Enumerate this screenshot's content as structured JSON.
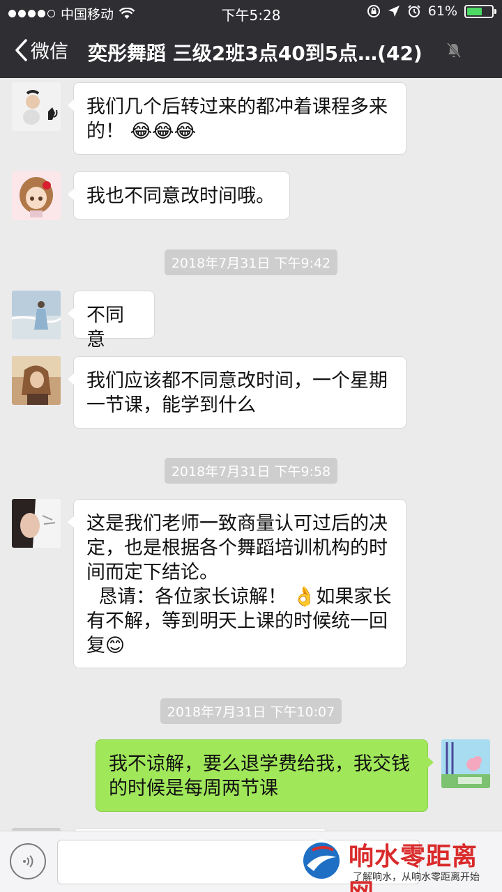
{
  "status_bar": {
    "carrier": "中国移动",
    "time": "下午5:28",
    "battery": "61%",
    "battery_level": 0.61
  },
  "nav": {
    "back_label": "微信",
    "title": "奕彤舞蹈 三级2班3点40到5点…(42)"
  },
  "messages": [
    {
      "type": "in",
      "text": "我们几个后转过来的都冲着课程多来\n的！ 😂😂😂"
    },
    {
      "type": "in",
      "text": "我也不同意改时间哦。"
    },
    {
      "type": "time",
      "text": "2018年7月31日 下午9:42"
    },
    {
      "type": "in",
      "text": "不同意"
    },
    {
      "type": "in",
      "text": "我们应该都不同意改时间，一个星期\n一节课，能学到什么"
    },
    {
      "type": "time",
      "text": "2018年7月31日 下午9:58"
    },
    {
      "type": "in",
      "text": "这是我们老师一致商量认可过后的决\n定，也是根据各个舞蹈培训机构的时\n间而定下结论。\n  恳请：各位家长谅解！ 👌如果家长\n有不解，等到明天上课的时候统一回\n复😊"
    },
    {
      "type": "time",
      "text": "2018年7月31日 下午10:07"
    },
    {
      "type": "out",
      "text": "我不谅解，要么退学费给我，我交钱\n的时候是每周两节课"
    }
  ],
  "watermark": {
    "title": "响水零距离网",
    "subtitle": "了解响水，从响水零距离开始"
  },
  "colors": {
    "nav_bg": "#2e2e33",
    "chat_bg": "#ebebeb",
    "out_bubble": "#a0e75a",
    "in_bubble": "#ffffff"
  }
}
